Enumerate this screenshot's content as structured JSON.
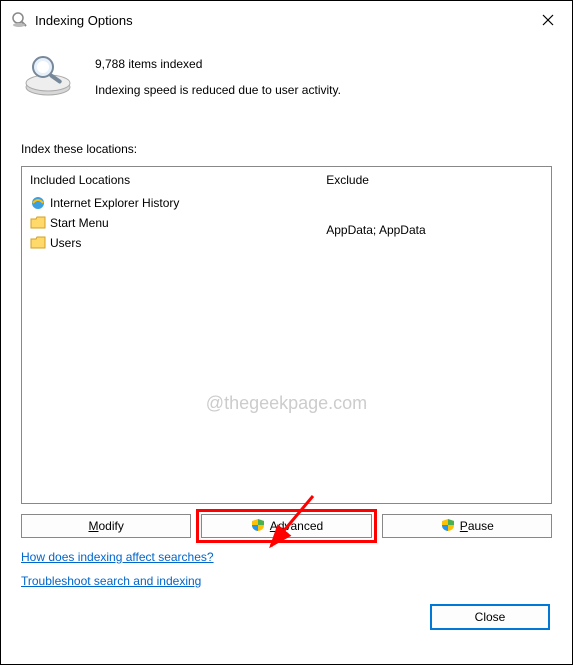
{
  "window": {
    "title": "Indexing Options"
  },
  "status": {
    "count_text": "9,788 items indexed",
    "speed_text": "Indexing speed is reduced due to user activity."
  },
  "section_label": "Index these locations:",
  "columns": {
    "included_header": "Included Locations",
    "exclude_header": "Exclude"
  },
  "locations": [
    {
      "name": "Internet Explorer History",
      "icon": "ie",
      "exclude": ""
    },
    {
      "name": "Start Menu",
      "icon": "folder",
      "exclude": ""
    },
    {
      "name": "Users",
      "icon": "folder",
      "exclude": "AppData; AppData"
    }
  ],
  "buttons": {
    "modify": "Modify",
    "advanced": "Advanced",
    "pause": "Pause",
    "close": "Close"
  },
  "links": {
    "how": "How does indexing affect searches?",
    "troubleshoot": "Troubleshoot search and indexing"
  },
  "watermark": "@thegeekpage.com"
}
